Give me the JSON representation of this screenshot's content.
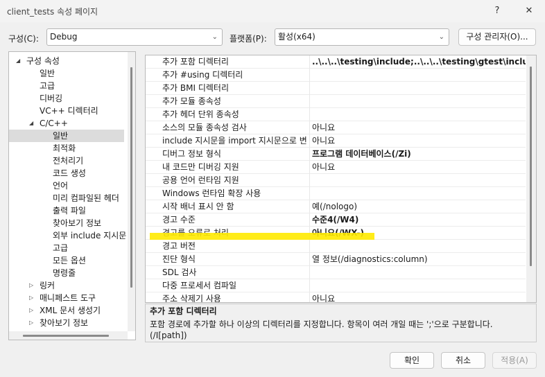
{
  "window": {
    "title": "client_tests 속성 페이지",
    "help_glyph": "?",
    "close_glyph": "✕"
  },
  "toolbar": {
    "config_label": "구성(C):",
    "config_value": "Debug",
    "platform_label": "플랫폼(P):",
    "platform_value": "활성(x64)",
    "config_manager_label": "구성 관리자(O)..."
  },
  "tree": {
    "items": [
      {
        "label": "구성 속성",
        "toggle": "◢"
      },
      {
        "label": "일반"
      },
      {
        "label": "고급"
      },
      {
        "label": "디버깅"
      },
      {
        "label": "VC++ 디렉터리"
      },
      {
        "label": "C/C++",
        "toggle": "◢"
      },
      {
        "label": "일반"
      },
      {
        "label": "최적화"
      },
      {
        "label": "전처리기"
      },
      {
        "label": "코드 생성"
      },
      {
        "label": "언어"
      },
      {
        "label": "미리 컴파일된 헤더"
      },
      {
        "label": "출력 파일"
      },
      {
        "label": "찾아보기 정보"
      },
      {
        "label": "외부 include 지시문"
      },
      {
        "label": "고급"
      },
      {
        "label": "모든 옵션"
      },
      {
        "label": "명령줄"
      },
      {
        "label": "링커",
        "toggle": "▷"
      },
      {
        "label": "매니페스트 도구",
        "toggle": "▷"
      },
      {
        "label": "XML 문서 생성기",
        "toggle": "▷"
      },
      {
        "label": "찾아보기 정보",
        "toggle": "▷"
      }
    ]
  },
  "grid": {
    "rows": [
      {
        "name": "추가 포함 디렉터리",
        "value": "..\\..\\..\\testing\\include;..\\..\\..\\testing\\gtest\\includ",
        "bold": true
      },
      {
        "name": "추가 #using 디렉터리",
        "value": ""
      },
      {
        "name": "추가 BMI 디렉터리",
        "value": ""
      },
      {
        "name": "추가 모듈 종속성",
        "value": ""
      },
      {
        "name": "추가 헤더 단위 종속성",
        "value": ""
      },
      {
        "name": "소스의 모듈 종속성 검사",
        "value": "아니요"
      },
      {
        "name": "include 지시문을 import 지시문으로 변",
        "value": "아니요"
      },
      {
        "name": "디버그 정보 형식",
        "value": "프로그램 데이터베이스(/Zi)",
        "bold": true
      },
      {
        "name": "내 코드만 디버깅 지원",
        "value": "아니요"
      },
      {
        "name": "공용 언어 런타임 지원",
        "value": ""
      },
      {
        "name": "Windows 런타임 확장 사용",
        "value": ""
      },
      {
        "name": "시작 배너 표시 안 함",
        "value": "예(/nologo)"
      },
      {
        "name": "경고 수준",
        "value": "수준4(/W4)",
        "bold": true
      },
      {
        "name": "경고를 오류로 처리",
        "value": "아니요(/WX-)",
        "bold": true
      },
      {
        "name": "경고 버전",
        "value": ""
      },
      {
        "name": "진단 형식",
        "value": "열 정보(/diagnostics:column)"
      },
      {
        "name": "SDL 검사",
        "value": ""
      },
      {
        "name": "다중 프로세서 컴파일",
        "value": ""
      },
      {
        "name": "주소 삭제기 사용",
        "value": "아니요"
      }
    ]
  },
  "description": {
    "title": "추가 포함 디렉터리",
    "text": "포함 경로에 추가할 하나 이상의 디렉터리를 지정합니다. 항목이 여러 개일 때는 ';'으로 구분합니다. (/I[path])"
  },
  "buttons": {
    "ok": "확인",
    "cancel": "취소",
    "apply": "적용(A)"
  }
}
